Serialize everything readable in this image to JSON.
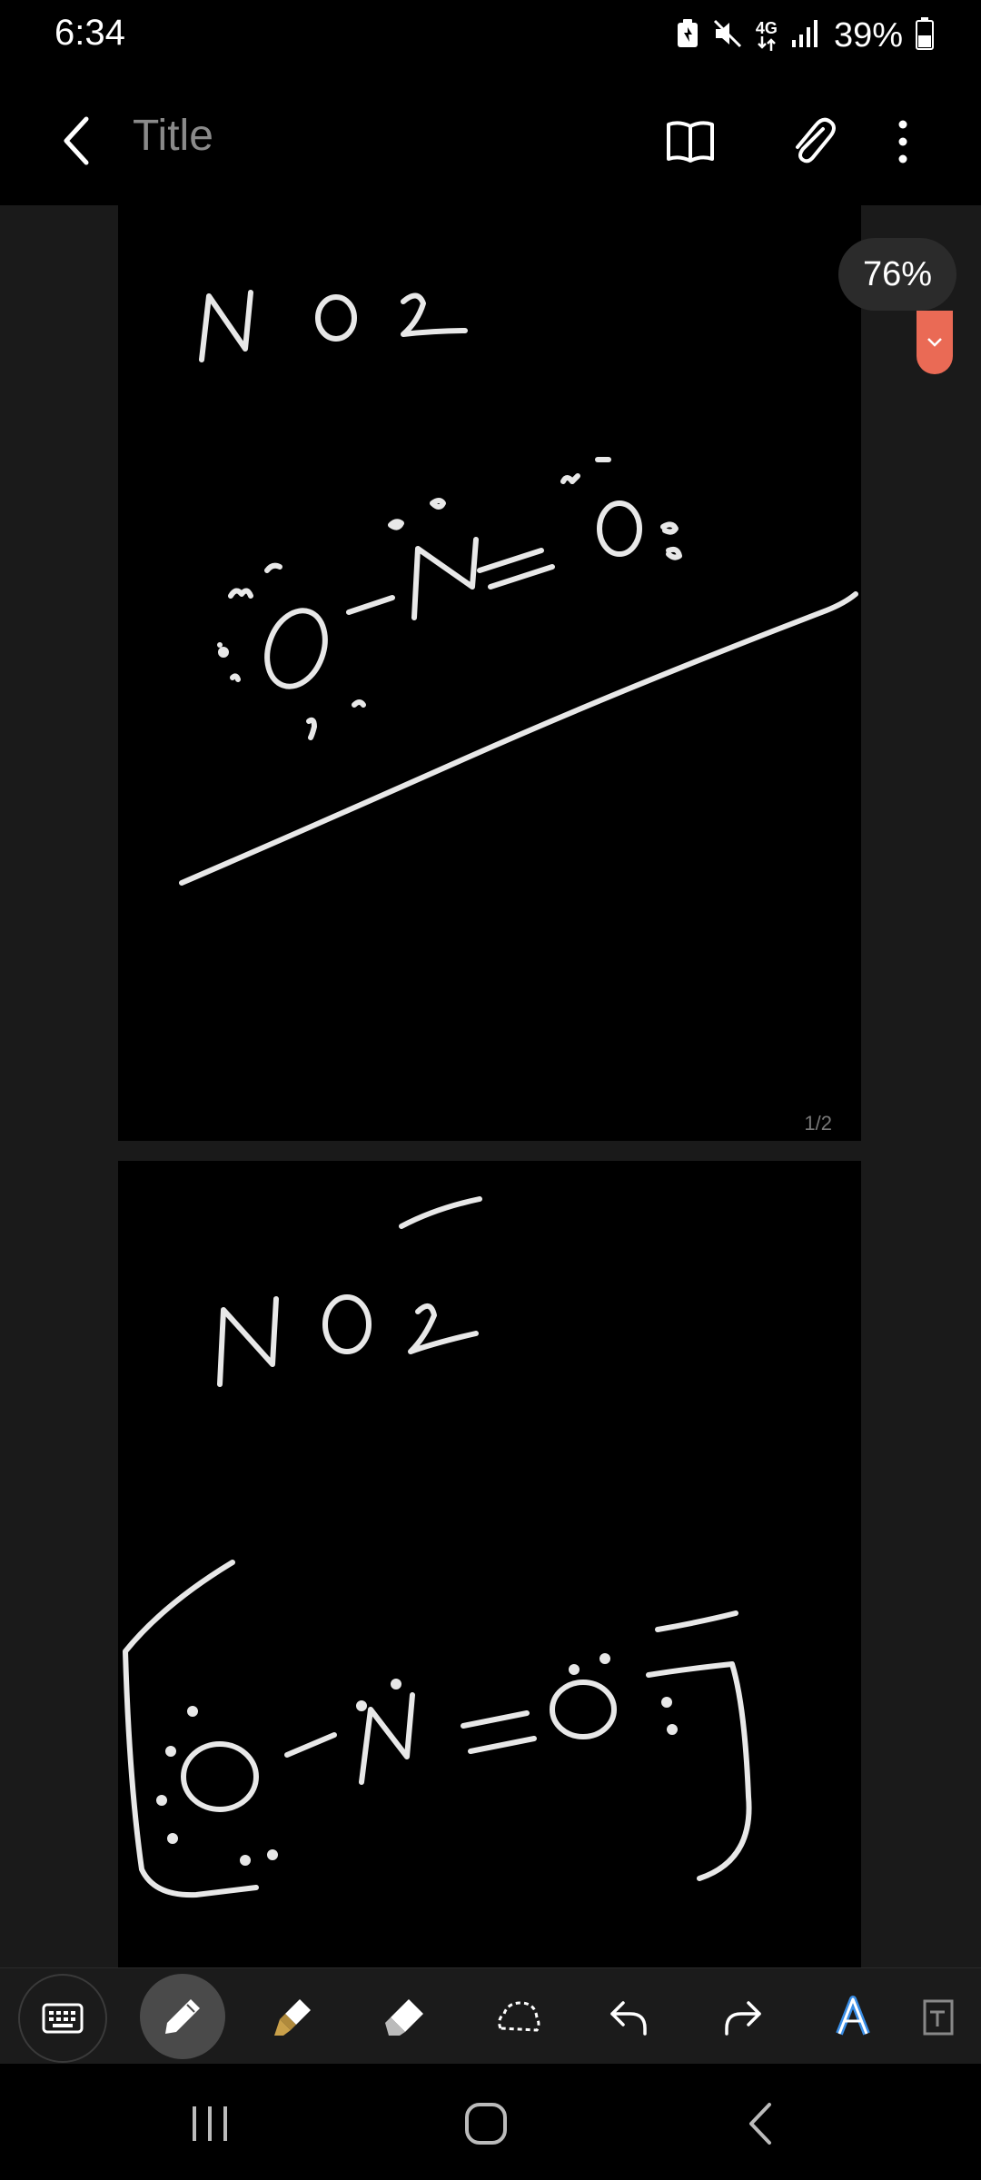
{
  "status_bar": {
    "time": "6:34",
    "network": "4G",
    "battery": "39%",
    "icons": [
      "battery-saver-icon",
      "mute-icon",
      "network-4g-icon",
      "signal-icon",
      "battery-icon"
    ]
  },
  "app_bar": {
    "title_placeholder": "Title",
    "actions": [
      "reading-mode-icon",
      "attach-icon",
      "more-icon"
    ]
  },
  "canvas": {
    "zoom": "76%",
    "pages": [
      {
        "page_label": "1/2"
      },
      {
        "page_label": ""
      }
    ],
    "background": "#000000",
    "ink_color": "#e8e8e8"
  },
  "toolbar": {
    "tools": [
      "keyboard",
      "pen",
      "highlighter",
      "eraser",
      "lasso-select",
      "undo",
      "redo",
      "text-style",
      "more-tools"
    ],
    "selected": "pen",
    "accent": "#3a8ee6"
  },
  "nav_bar": {
    "buttons": [
      "recents",
      "home",
      "back"
    ]
  }
}
